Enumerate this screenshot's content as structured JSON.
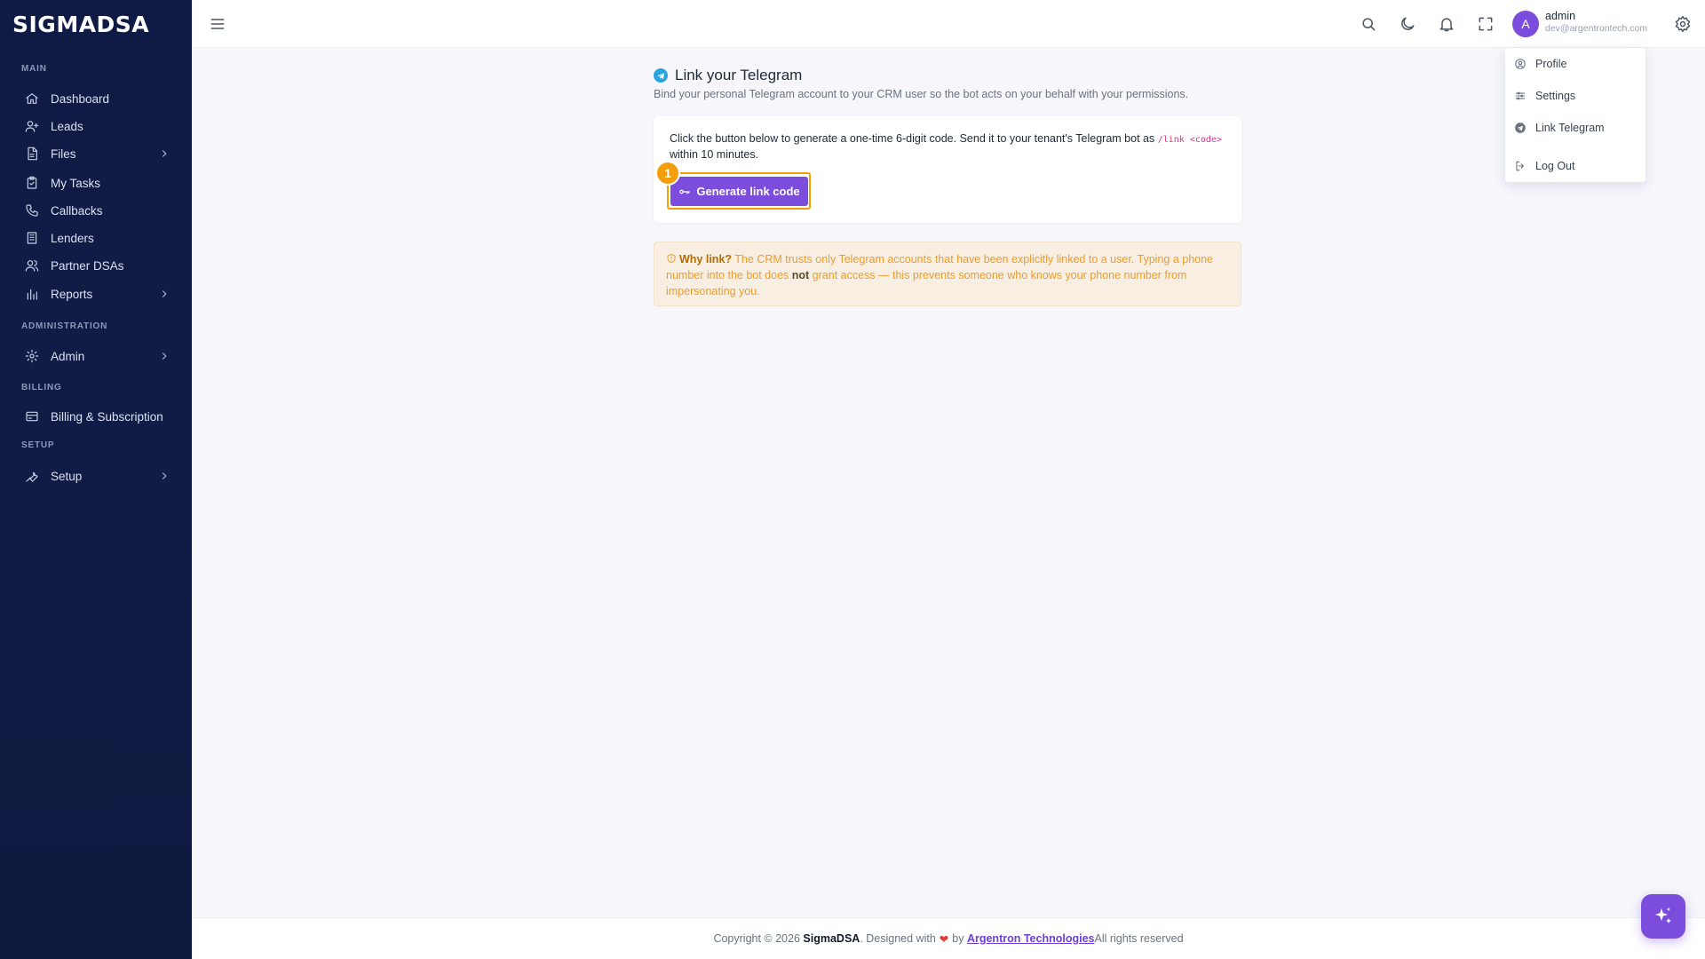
{
  "app": {
    "logo": "SIGMADSA"
  },
  "sidebar": {
    "sections": {
      "main": "MAIN",
      "administration": "ADMINISTRATION",
      "billing": "BILLING",
      "setup": "SETUP"
    },
    "items": [
      {
        "label": "Dashboard",
        "icon": "home-icon"
      },
      {
        "label": "Leads",
        "icon": "user-plus-icon"
      },
      {
        "label": "Files",
        "icon": "file-icon"
      },
      {
        "label": "My Tasks",
        "icon": "clipboard-check-icon"
      },
      {
        "label": "Callbacks",
        "icon": "phone-icon"
      },
      {
        "label": "Lenders",
        "icon": "building-icon"
      },
      {
        "label": "Partner DSAs",
        "icon": "users-icon"
      },
      {
        "label": "Reports",
        "icon": "bar-chart-icon"
      },
      {
        "label": "Admin",
        "icon": "gear-icon"
      },
      {
        "label": "Billing & Subscription",
        "icon": "credit-card-icon"
      },
      {
        "label": "Setup",
        "icon": "wrench-icon"
      }
    ]
  },
  "topbar": {
    "user": {
      "initial": "A",
      "name": "admin",
      "email": "dev@argentrontech.com"
    }
  },
  "user_menu": {
    "items": [
      {
        "label": "Profile",
        "icon": "user-circle-icon"
      },
      {
        "label": "Settings",
        "icon": "sliders-icon"
      },
      {
        "label": "Link Telegram",
        "icon": "telegram-icon"
      },
      {
        "label": "Log Out",
        "icon": "logout-icon"
      }
    ]
  },
  "main": {
    "title": "Link your Telegram",
    "subtitle": "Bind your personal Telegram account to your CRM user so the bot acts on your behalf with your permissions.",
    "card": {
      "text_before": "Click the button below to generate a one-time 6-digit code. Send it to your tenant's Telegram bot as ",
      "command": "/link <code>",
      "text_after": " within 10 minutes.",
      "button_label": "Generate link code",
      "step_badge": "1"
    },
    "alert": {
      "lead": "Why link?",
      "text1": " The CRM trusts only Telegram accounts that have been explicitly linked to a user. Typing a phone number into the bot does ",
      "emphasis": "not",
      "text2": " grant access — this prevents someone who knows your phone number from impersonating you."
    }
  },
  "footer": {
    "prefix": "Copyright © 2026 ",
    "brand": "SigmaDSA",
    "designed": ". Designed with",
    "by": "by",
    "company": "Argentron Technologies",
    "suffix": " All rights reserved"
  },
  "colors": {
    "accent": "#7c4ddd",
    "sidebar": "#101b45",
    "warning": "#f59e0b",
    "telegram": "#2aa3df"
  }
}
